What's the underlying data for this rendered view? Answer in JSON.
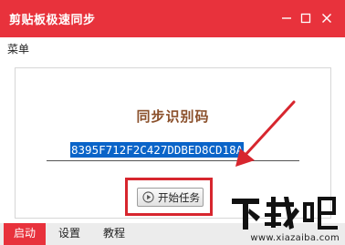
{
  "window": {
    "title": "剪贴板极速同步",
    "accent_color": "#e8323c"
  },
  "titlebar_controls": {
    "minimize_icon": "minimize-icon",
    "maximize_icon": "maximize-icon",
    "close_icon": "close-icon"
  },
  "menu": {
    "label": "菜单"
  },
  "main": {
    "heading": "同步识别码",
    "code": "8395F712F2C427DDBED8CD18A",
    "code_selected": true,
    "start_button_label": "开始任务",
    "start_icon": "play-circle-icon",
    "highlight_color": "#d7262e"
  },
  "tabs": [
    {
      "label": "启动",
      "active": true
    },
    {
      "label": "设置",
      "active": false
    },
    {
      "label": "教程",
      "active": false
    }
  ],
  "watermark": {
    "logo_text": "下载吧",
    "url": "www.xiazaiba.com"
  }
}
